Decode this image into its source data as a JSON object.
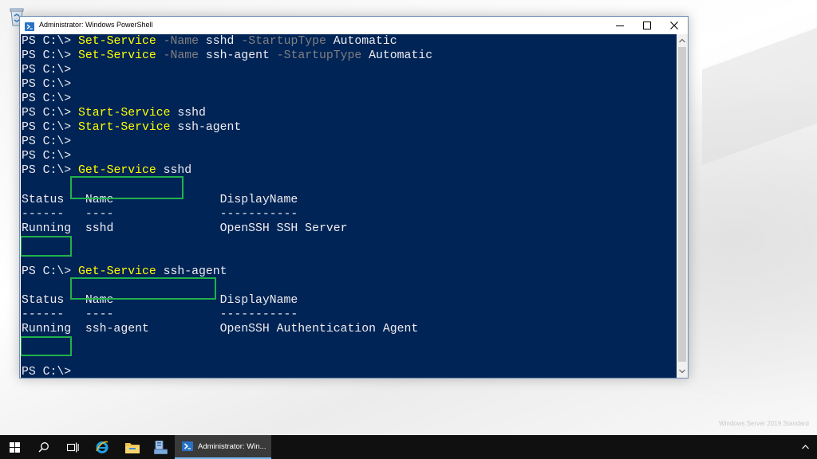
{
  "window": {
    "title": "Administrator: Windows PowerShell"
  },
  "console": {
    "lines": [
      [
        {
          "t": "PS C:\\> ",
          "c": "out"
        },
        {
          "t": "Set-Service",
          "c": "cmd"
        },
        {
          "t": " ",
          "c": "out"
        },
        {
          "t": "-Name",
          "c": "param"
        },
        {
          "t": " sshd ",
          "c": "out"
        },
        {
          "t": "-StartupType",
          "c": "param"
        },
        {
          "t": " Automatic",
          "c": "out"
        }
      ],
      [
        {
          "t": "PS C:\\> ",
          "c": "out"
        },
        {
          "t": "Set-Service",
          "c": "cmd"
        },
        {
          "t": " ",
          "c": "out"
        },
        {
          "t": "-Name",
          "c": "param"
        },
        {
          "t": " ssh-agent ",
          "c": "out"
        },
        {
          "t": "-StartupType",
          "c": "param"
        },
        {
          "t": " Automatic",
          "c": "out"
        }
      ],
      [
        {
          "t": "PS C:\\>",
          "c": "out"
        }
      ],
      [
        {
          "t": "PS C:\\>",
          "c": "out"
        }
      ],
      [
        {
          "t": "PS C:\\>",
          "c": "out"
        }
      ],
      [
        {
          "t": "PS C:\\> ",
          "c": "out"
        },
        {
          "t": "Start-Service",
          "c": "cmd"
        },
        {
          "t": " sshd",
          "c": "out"
        }
      ],
      [
        {
          "t": "PS C:\\> ",
          "c": "out"
        },
        {
          "t": "Start-Service",
          "c": "cmd"
        },
        {
          "t": " ssh-agent",
          "c": "out"
        }
      ],
      [
        {
          "t": "PS C:\\>",
          "c": "out"
        }
      ],
      [
        {
          "t": "PS C:\\>",
          "c": "out"
        }
      ],
      [
        {
          "t": "PS C:\\> ",
          "c": "out"
        },
        {
          "t": "Get-Service",
          "c": "cmd"
        },
        {
          "t": " sshd",
          "c": "out"
        }
      ],
      [],
      [
        {
          "t": "Status   Name               DisplayName",
          "c": "out"
        }
      ],
      [
        {
          "t": "------   ----               -----------",
          "c": "out"
        }
      ],
      [
        {
          "t": "Running  sshd               OpenSSH SSH Server",
          "c": "out"
        }
      ],
      [],
      [],
      [
        {
          "t": "PS C:\\> ",
          "c": "out"
        },
        {
          "t": "Get-Service",
          "c": "cmd"
        },
        {
          "t": " ssh-agent",
          "c": "out"
        }
      ],
      [],
      [
        {
          "t": "Status   Name               DisplayName",
          "c": "out"
        }
      ],
      [
        {
          "t": "------   ----               -----------",
          "c": "out"
        }
      ],
      [
        {
          "t": "Running  ssh-agent          OpenSSH Authentication Agent",
          "c": "out"
        }
      ],
      [],
      [],
      [
        {
          "t": "PS C:\\>",
          "c": "out"
        }
      ]
    ]
  },
  "taskbar": {
    "active_app_label": "Administrator: Win..."
  },
  "watermark": {
    "line1": "Windows Server 2019 Standard"
  },
  "colors": {
    "console_bg": "#012456",
    "console_fg": "#eeedf0",
    "command": "#ffff00",
    "parameter": "#808080",
    "highlight": "#1fb24a",
    "taskbar": "#101010"
  }
}
